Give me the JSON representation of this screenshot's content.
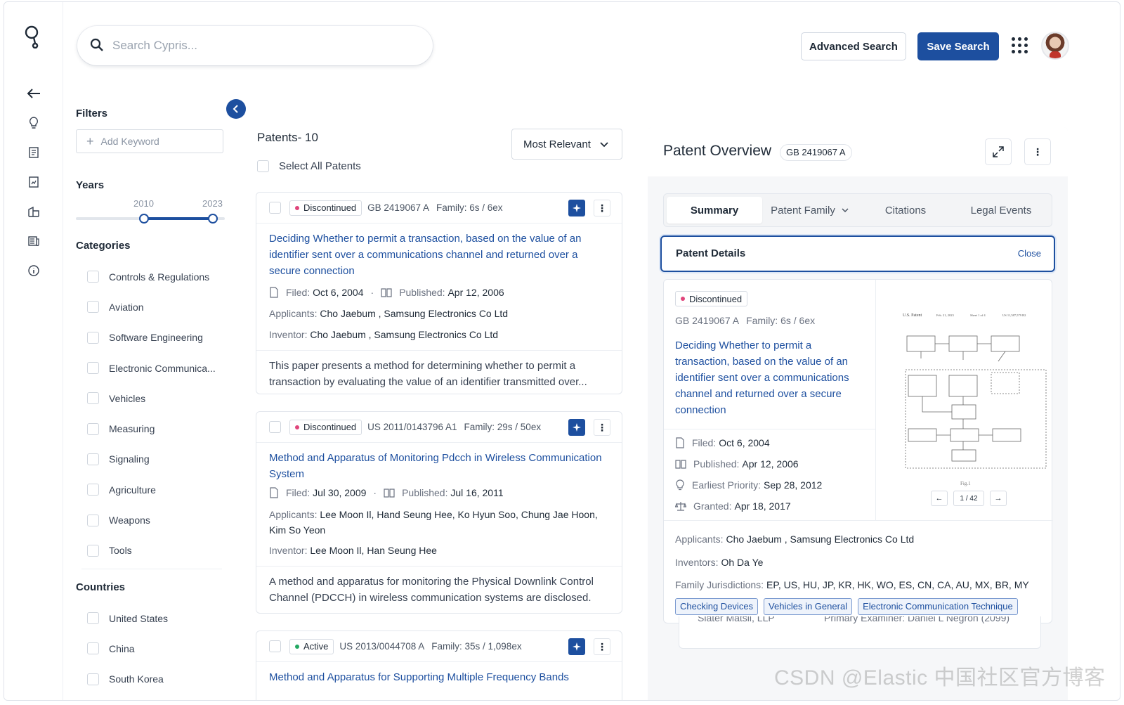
{
  "search": {
    "placeholder": "Search Cypris..."
  },
  "topbar": {
    "advanced_search": "Advanced Search",
    "save_search": "Save Search"
  },
  "filters": {
    "title": "Filters",
    "add_keyword": "Add Keyword",
    "years_title": "Years",
    "year_from": "2010",
    "year_to": "2023",
    "categories_title": "Categories",
    "categories": [
      "Controls & Regulations",
      "Aviation",
      "Software Engineering",
      "Electronic Communica...",
      "Vehicles",
      "Measuring",
      "Signaling",
      "Agriculture",
      "Weapons",
      "Tools"
    ],
    "countries_title": "Countries",
    "countries": [
      "United States",
      "China",
      "South Korea"
    ]
  },
  "results": {
    "heading": "Patents- 10",
    "select_all": "Select All Patents",
    "sort": "Most Relevant",
    "cards": [
      {
        "status": "Discontinued",
        "status_color": "#e0457b",
        "number": "GB 2419067 A",
        "family": "Family: 6s / 6ex",
        "title": "Deciding Whether to permit a transaction, based on the value of an identifier sent over a communications channel and returned over a secure connection",
        "filed_label": "Filed:",
        "filed": "Oct 6, 2004",
        "published_label": "Published:",
        "published": "Apr 12, 2006",
        "applicants_label": "Applicants:",
        "applicants": "Cho Jaebum , Samsung Electronics Co Ltd",
        "inventor_label": "Inventor:",
        "inventor": "Cho Jaebum , Samsung Electronics Co Ltd",
        "abstract": "This paper presents a method for determining whether to permit a transaction by evaluating the value of an identifier transmitted over..."
      },
      {
        "status": "Discontinued",
        "status_color": "#e0457b",
        "number": "US 2011/0143796 A1",
        "family": "Family: 29s / 50ex",
        "title": "Method and Apparatus of Monitoring Pdcch in Wireless Communication System",
        "filed_label": "Filed:",
        "filed": "Jul 30, 2009",
        "published_label": "Published:",
        "published": "Jul 16, 2011",
        "applicants_label": "Applicants:",
        "applicants": "Lee Moon Il, Hand Seung Hee, Ko Hyun Soo, Chung Jae Hoon, Kim So Yeon",
        "inventor_label": "Inventor:",
        "inventor": "Lee Moon Il, Han Seung Hee",
        "abstract": "A method and apparatus for monitoring the Physical Downlink Control Channel (PDCCH) in wireless communication systems are disclosed."
      },
      {
        "status": "Active",
        "status_color": "#22a861",
        "number": "US 2013/0044708 A",
        "family": "Family: 35s / 1,098ex",
        "title": "Method and Apparatus for Supporting Multiple Frequency Bands"
      }
    ]
  },
  "overview": {
    "title": "Patent Overview",
    "number": "GB 2419067 A",
    "tabs": [
      "Summary",
      "Patent Family",
      "Citations",
      "Legal Events"
    ],
    "details_title": "Patent Details",
    "close": "Close",
    "status": "Discontinued",
    "family": "Family: 6s / 6ex",
    "title_text": "Deciding Whether to permit a transaction, based on the value of an identifier sent over a communications channel and returned over a secure connection",
    "filed_label": "Filed:",
    "filed": "Oct 6, 2004",
    "published_label": "Published:",
    "published": "Apr 12, 2006",
    "priority_label": "Earliest Priority:",
    "priority": "Sep 28, 2012",
    "granted_label": "Granted:",
    "granted": "Apr 18, 2017",
    "applicants_label": "Applicants:",
    "applicants": "Cho Jaebum , Samsung Electronics Co Ltd",
    "inventors_label": "Inventors:",
    "inventors": "Oh Da Ye",
    "jurisdictions_label": "Family Jurisdictions:",
    "jurisdictions": "EP, US, HU, JP, KR, HK, WO, ES, CN, CA, AU, MX, BR, MY",
    "tags": [
      "Checking Devices",
      "Vehicles in General",
      "Electronic Communication Technique"
    ],
    "figure_page": "1 / 42",
    "figure_caption": "Fig.1",
    "figure_header": [
      "U.S. Patent",
      "Feb. 21, 2023",
      "Sheet 1 of 4",
      "US 11,587,579 B2"
    ],
    "ghost_left": "Slater Matsil, LLP",
    "ghost_right": "Primary Examiner: Daniel L Negron (2099)"
  },
  "watermark": "CSDN @Elastic 中国社区官方博客"
}
